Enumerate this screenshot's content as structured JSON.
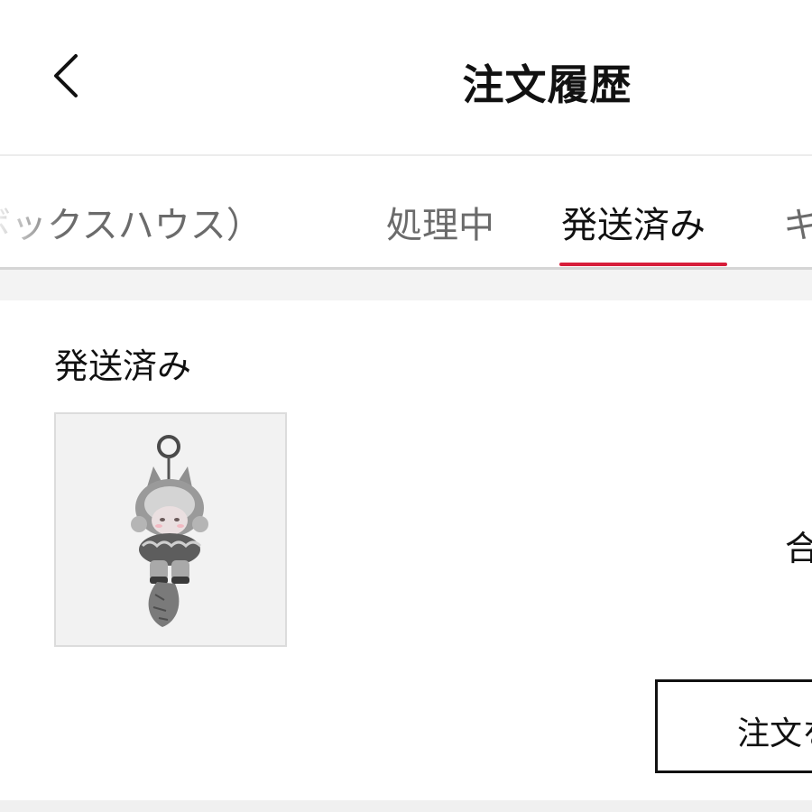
{
  "header": {
    "title": "注文履歴",
    "back_icon": "chevron-left-icon"
  },
  "tabs": [
    {
      "label": "ボックスハウス）",
      "active": false
    },
    {
      "label": "処理中",
      "active": false
    },
    {
      "label": "発送済み",
      "active": true
    },
    {
      "label": "キ",
      "active": false
    }
  ],
  "colors": {
    "active_indicator": "#d71d3a",
    "inactive_tab_text": "#6b6b6b",
    "section_background": "#f3f3f3"
  },
  "order": {
    "status": "発送済み",
    "product_image": "wolf-figure-keychain",
    "total_label": "合",
    "action_label": "注文を"
  }
}
